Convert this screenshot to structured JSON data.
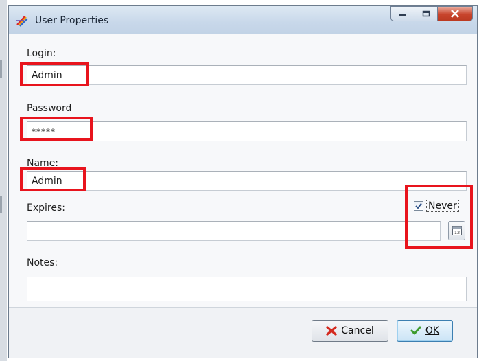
{
  "window": {
    "title": "User Properties",
    "controls": {
      "minimize": "minimize",
      "maximize": "maximize",
      "close": "close"
    }
  },
  "form": {
    "login": {
      "label": "Login:",
      "value": "Admin"
    },
    "password": {
      "label": "Password",
      "value": "*****"
    },
    "name": {
      "label": "Name:",
      "value": "Admin"
    },
    "expires": {
      "label": "Expires:",
      "value": "",
      "never_label": "Never",
      "never_checked": true
    },
    "notes": {
      "label": "Notes:",
      "value": ""
    }
  },
  "buttons": {
    "cancel": "Cancel",
    "ok": "OK"
  },
  "icons": {
    "app": "app-logo-icon",
    "calendar": "calendar-icon",
    "cancel": "red-x-icon",
    "ok": "green-check-icon"
  },
  "colors": {
    "highlight": "#e8141d",
    "titlebar": "#c8d8ea",
    "close_button": "#c8452d"
  }
}
